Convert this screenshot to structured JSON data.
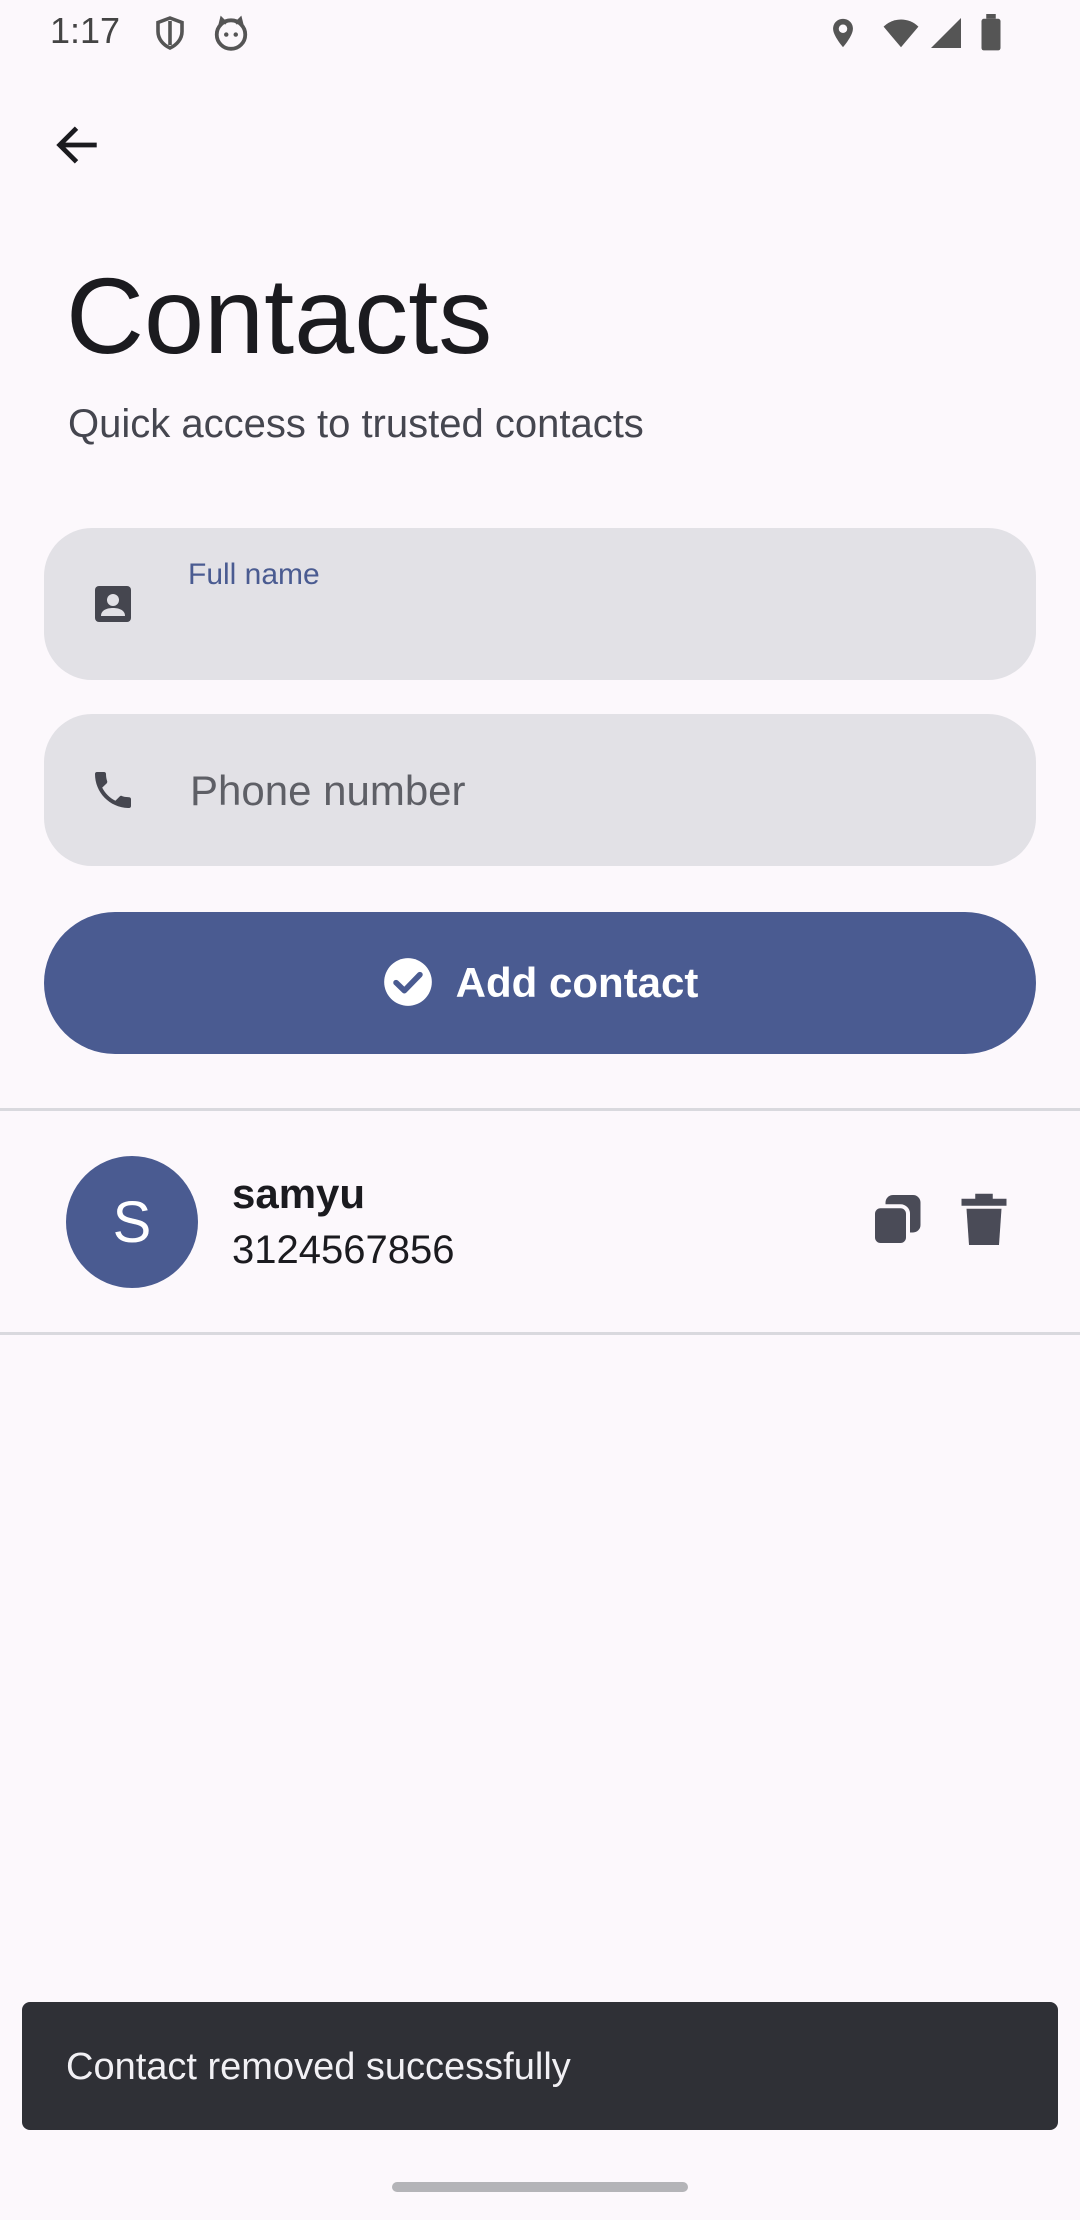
{
  "status_bar": {
    "time": "1:17",
    "left_icons": [
      "shield-icon",
      "cat-icon"
    ],
    "right_icons": [
      "location-icon",
      "wifi-icon",
      "signal-icon",
      "battery-icon"
    ]
  },
  "app_bar": {
    "back_icon": "arrow-back-icon"
  },
  "header": {
    "title": "Contacts",
    "subtitle": "Quick access to trusted contacts"
  },
  "form": {
    "name_field": {
      "icon": "contact-card-icon",
      "label": "Full name",
      "value": ""
    },
    "phone_field": {
      "icon": "phone-icon",
      "placeholder": "Phone number",
      "value": ""
    },
    "add_button": {
      "icon": "check-circle-icon",
      "label": "Add contact"
    }
  },
  "contacts": [
    {
      "initial": "S",
      "name": "samyu",
      "phone": "3124567856",
      "actions": [
        "copy-icon",
        "delete-icon"
      ]
    }
  ],
  "snackbar": {
    "message": "Contact removed successfully"
  },
  "colors": {
    "background": "#fcf8fc",
    "primary": "#4a5b91",
    "field_bg": "#e2e1e6",
    "snackbar_bg": "#2f3036",
    "on_primary": "#ffffff"
  }
}
